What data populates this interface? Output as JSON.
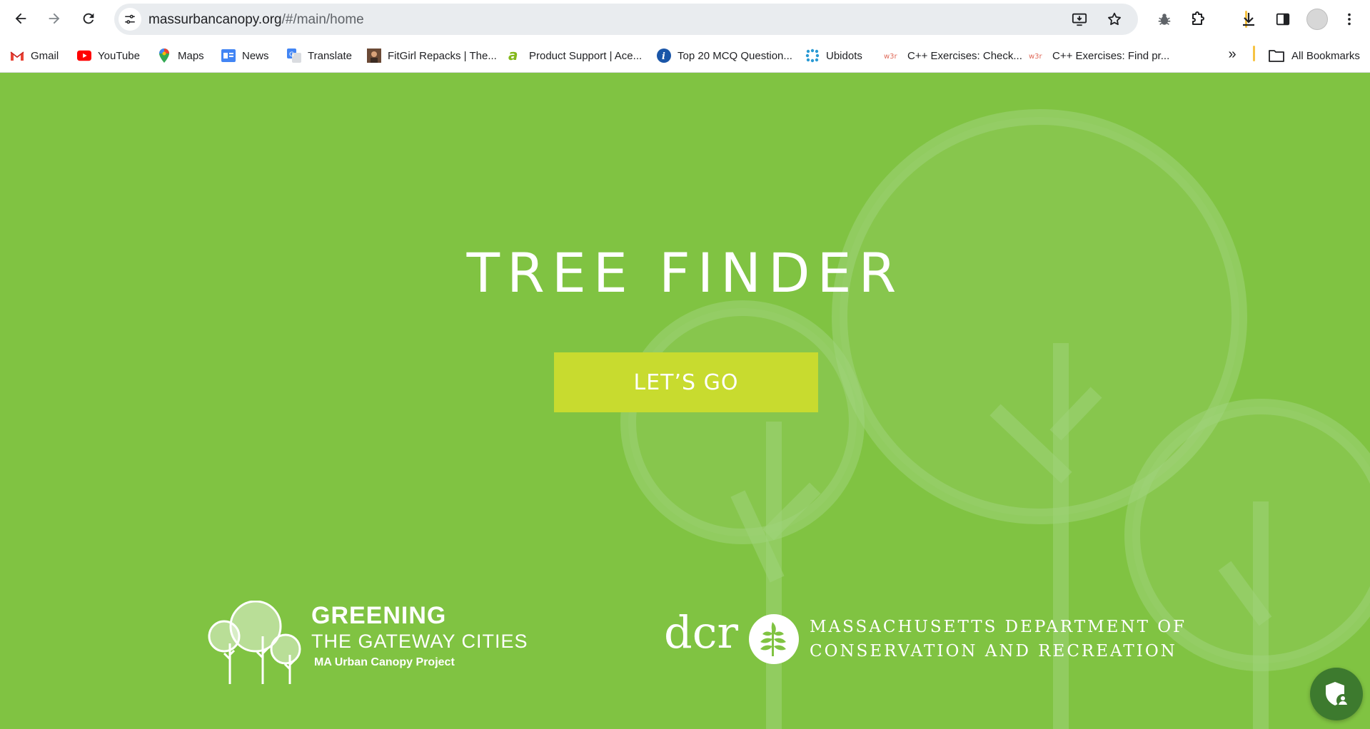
{
  "browser": {
    "url_host": "massurbancanopy.org",
    "url_path": "/#/main/home",
    "profile_colors": {
      "separator": "#f6c343"
    },
    "bookmarks": [
      {
        "label": "Gmail",
        "icon": "gmail-icon"
      },
      {
        "label": "YouTube",
        "icon": "youtube-icon"
      },
      {
        "label": "Maps",
        "icon": "maps-icon"
      },
      {
        "label": "News",
        "icon": "news-icon"
      },
      {
        "label": "Translate",
        "icon": "translate-icon"
      },
      {
        "label": "FitGirl Repacks | The...",
        "icon": "fitgirl-icon"
      },
      {
        "label": "Product Support | Ace...",
        "icon": "acer-icon"
      },
      {
        "label": "Top 20 MCQ Question...",
        "icon": "info-icon"
      },
      {
        "label": "Ubidots",
        "icon": "ubidots-icon"
      },
      {
        "label": "C++ Exercises: Check...",
        "icon": "w3r-icon"
      },
      {
        "label": "C++ Exercises: Find pr...",
        "icon": "w3r-icon"
      }
    ],
    "more_bookmarks": "»",
    "all_bookmarks": "All Bookmarks"
  },
  "page": {
    "background_color": "#80c342",
    "title": "TREE FINDER",
    "cta_label": "LET’S GO",
    "cta_color": "#c8db2f",
    "logo_ggc": {
      "line1": "GREENING",
      "line2": "THE GATEWAY CITIES",
      "line3": "MA Urban Canopy Project"
    },
    "logo_dcr": {
      "word": "dcr",
      "line1": "MASSACHUSETTS DEPARTMENT OF",
      "line2": "CONSERVATION AND RECREATION"
    },
    "chat_widget_icon": "shield-user-icon"
  }
}
